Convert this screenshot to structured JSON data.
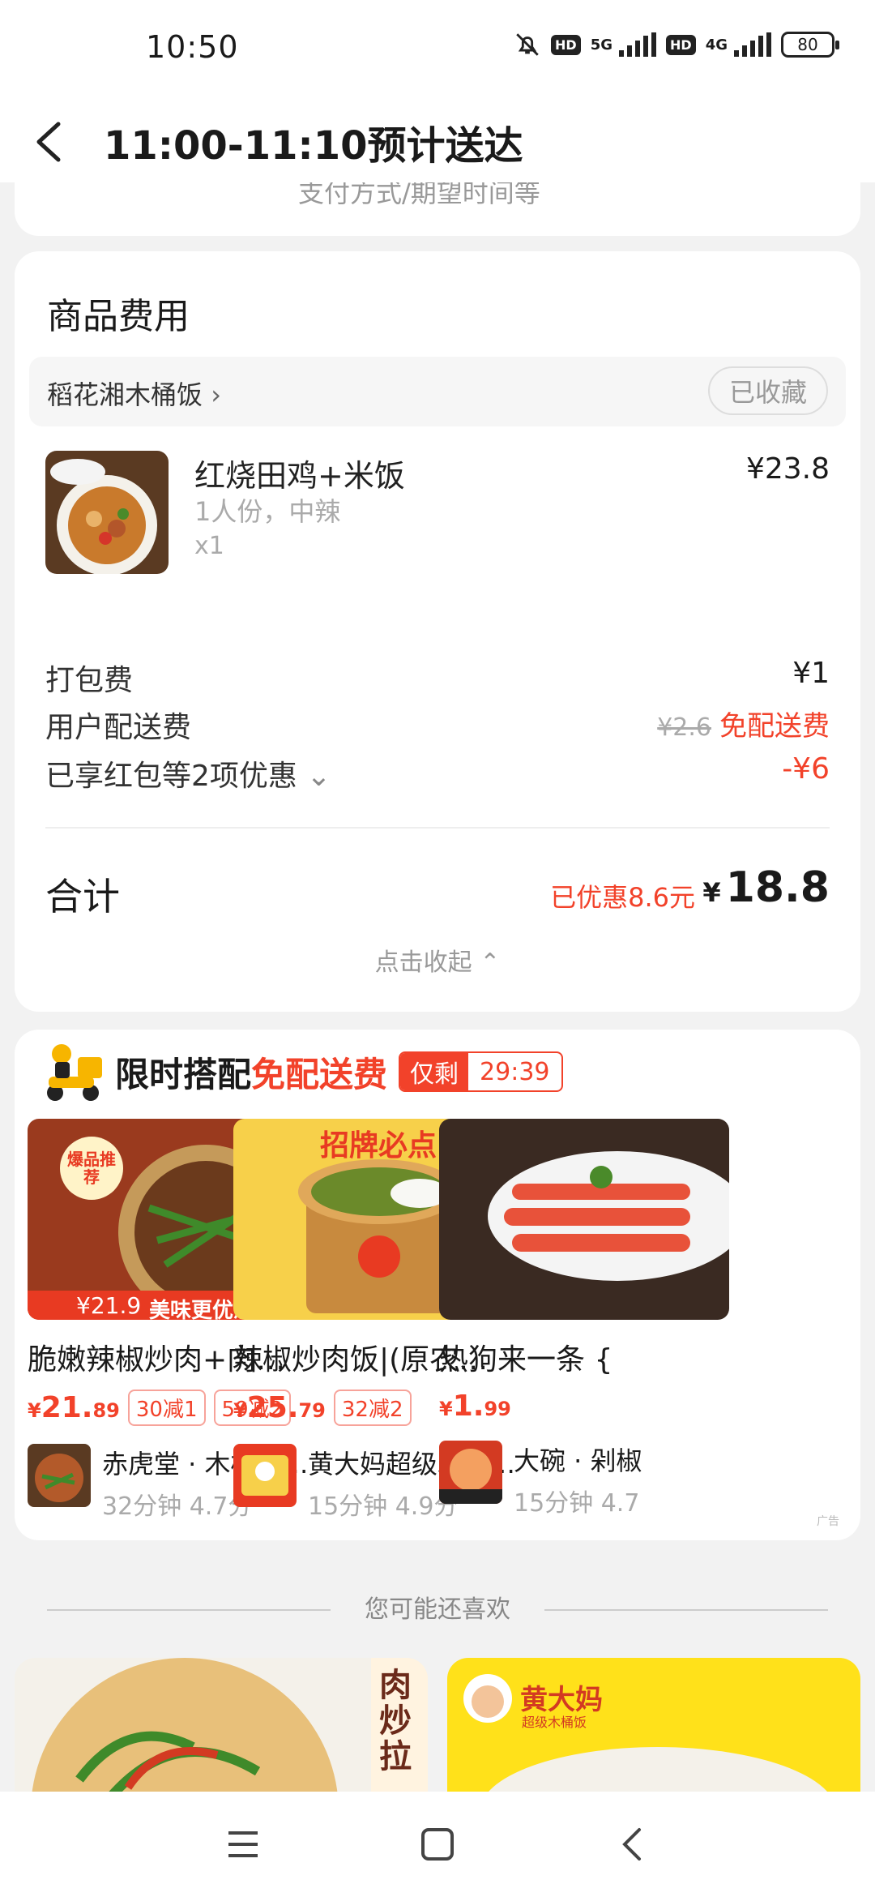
{
  "status": {
    "time": "10:50",
    "hd1": "HD",
    "net1": "5G",
    "hd2": "HD",
    "net2": "4G",
    "battery": "80"
  },
  "header": {
    "title": "11:00-11:10预计送达"
  },
  "top_card": {
    "hint": "支付方式/期望时间等"
  },
  "fee": {
    "title": "商品费用",
    "shop_name": "稻花湘木桶饭",
    "fav_label": "已收藏",
    "item": {
      "name": "红烧田鸡+米饭",
      "spec": "1人份，中辣",
      "qty": "x1",
      "price": "¥23.8"
    },
    "packing": {
      "label": "打包费",
      "value": "¥1"
    },
    "delivery": {
      "label": "用户配送费",
      "original": "¥2.6",
      "value": "免配送费"
    },
    "discount": {
      "label": "已享红包等2项优惠",
      "value": "-¥6"
    },
    "total": {
      "label": "合计",
      "saved": "已优惠8.6元",
      "currency": "¥",
      "value": "18.8"
    },
    "collapse": "点击收起"
  },
  "promo": {
    "title": "限时搭配",
    "free": "免配送费",
    "countdown_label": "仅剩",
    "countdown": "29:39",
    "ad": "广告",
    "deals": [
      {
        "name": "脆嫩辣椒炒肉+肉…",
        "price_int": "21.",
        "price_dec": "89",
        "coupons": [
          "30减1",
          "59减2"
        ],
        "shop": "赤虎堂 · 木桶饭…",
        "meta": "32分钟 4.7分",
        "badge": "爆品推荐",
        "img_price": "¥21.9",
        "img_tag": "美味更优惠"
      },
      {
        "name": "辣椒炒肉饭|(原农…",
        "price_int": "25.",
        "price_dec": "79",
        "coupons": [
          "32减2"
        ],
        "shop": "黄大妈超级木桶…",
        "meta": "15分钟 4.9分",
        "badge": "招牌必点",
        "img_price": "",
        "img_tag": ""
      },
      {
        "name": "热狗来一条 {",
        "price_int": "1.",
        "price_dec": "99",
        "coupons": [],
        "shop": "大碗 · 剁椒",
        "meta": "15分钟 4.7",
        "badge": "",
        "img_price": "",
        "img_tag": ""
      }
    ]
  },
  "reco": {
    "title": "您可能还喜欢",
    "card1_text": "肉炒拉",
    "card2_text": "黄大妈",
    "card2_sub": "超级木桶饭"
  },
  "colors": {
    "accent": "#f2422a",
    "background": "#f2f2f2"
  }
}
